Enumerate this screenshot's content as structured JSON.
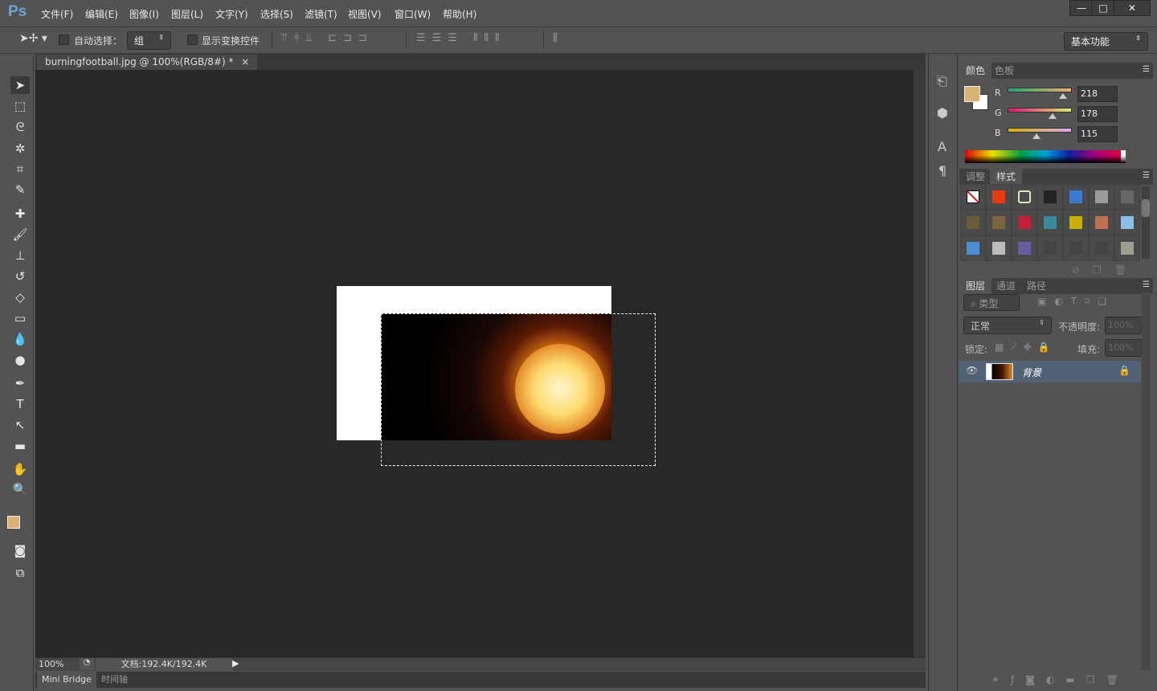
{
  "app": {
    "logo": "Ps",
    "menu": [
      "文件(F)",
      "编辑(E)",
      "图像(I)",
      "图层(L)",
      "文字(Y)",
      "选择(S)",
      "滤镜(T)",
      "视图(V)",
      "窗口(W)",
      "帮助(H)"
    ],
    "window_controls": [
      "—",
      "□",
      "✕"
    ]
  },
  "options": {
    "auto_select_label": "自动选择：",
    "auto_select_checked": false,
    "auto_select_value": "组",
    "show_transform_label": "显示变换控件",
    "show_transform_checked": false,
    "workspace": "基本功能"
  },
  "document": {
    "tab_title": "burningfootball.jpg @ 100%(RGB/8#) *",
    "close": "×"
  },
  "status": {
    "zoom": "100%",
    "doc_info": "文档:192.4K/192.4K"
  },
  "bottom_tabs": [
    "Mini Bridge",
    "时间轴"
  ],
  "color_panel": {
    "tabs": [
      "颜色",
      "色板"
    ],
    "active_tab": 0,
    "foreground": "#dab273",
    "background": "#ffffff",
    "channels": [
      {
        "label": "R",
        "value": "218"
      },
      {
        "label": "G",
        "value": "178"
      },
      {
        "label": "B",
        "value": "115"
      }
    ]
  },
  "styles_panel": {
    "tabs": [
      "调整",
      "样式"
    ],
    "active_tab": 1,
    "swatches": [
      "none",
      "#e83a10",
      "#4a4a4a",
      "#222",
      "#3a7cd0",
      "#9a9a9a",
      "#666",
      "#6b5a3a",
      "#7a6540",
      "#c0203a",
      "#3a8a9a",
      "#c8b000",
      "#c07050",
      "#8ac0e8",
      "#4a90d0",
      "#bbb",
      "#6a5aa0",
      "#444",
      "#444",
      "#444",
      "#a0a090"
    ]
  },
  "layers_panel": {
    "tabs": [
      "图层",
      "通道",
      "路径"
    ],
    "active_tab": 0,
    "filter": "类型",
    "blend_mode": "正常",
    "opacity_label": "不透明度:",
    "opacity": "100%",
    "lock_label": "锁定:",
    "fill_label": "填充:",
    "fill": "100%",
    "layers": [
      {
        "name": "背景",
        "visible": true,
        "locked": true
      }
    ]
  }
}
